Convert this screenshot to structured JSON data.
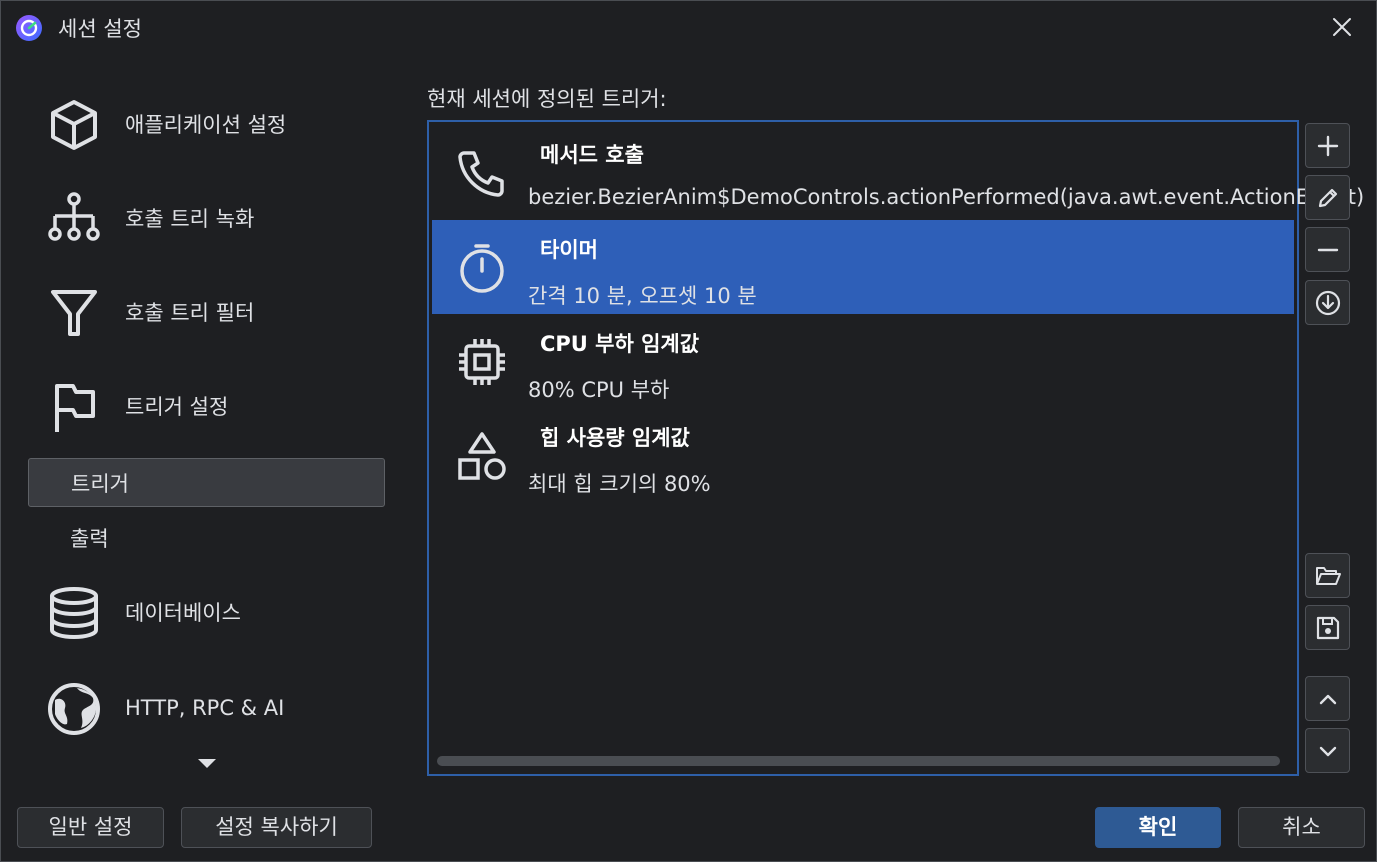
{
  "window": {
    "title": "세션 설정",
    "app_icon": "app-logo-icon",
    "close_icon": "close-icon"
  },
  "sidebar": {
    "items": [
      {
        "label": "애플리케이션 설정",
        "icon": "cube-icon"
      },
      {
        "label": "호출 트리 녹화",
        "icon": "tree-icon"
      },
      {
        "label": "호출 트리 필터",
        "icon": "filter-icon"
      },
      {
        "label": "트리거 설정",
        "icon": "flag-icon"
      },
      {
        "label": "데이터베이스",
        "icon": "database-icon"
      },
      {
        "label": "HTTP, RPC & AI",
        "icon": "globe-icon"
      }
    ],
    "subitems": [
      {
        "label": "트리거",
        "selected": true
      },
      {
        "label": "출력",
        "selected": false
      }
    ],
    "more_icon": "chevron-down-icon"
  },
  "main": {
    "label": "현재 세션에 정의된 트리거:",
    "triggers": [
      {
        "title": "메서드 호출",
        "desc": "bezier.BezierAnim$DemoControls.actionPerformed(java.awt.event.ActionEvent)",
        "icon": "phone-icon",
        "selected": false
      },
      {
        "title": "타이머",
        "desc": "간격 10 분, 오프셋 10 분",
        "icon": "stopwatch-icon",
        "selected": true
      },
      {
        "title": "CPU 부하 임계값",
        "desc": "80% CPU 부하",
        "icon": "cpu-icon",
        "selected": false
      },
      {
        "title": "힙 사용량 임계값",
        "desc": "최대 힙 크기의 80%",
        "icon": "shapes-icon",
        "selected": false
      }
    ]
  },
  "side_buttons": [
    "plus-icon",
    "edit-icon",
    "minus-icon",
    "import-icon",
    "folder-open-icon",
    "save-icon",
    "chevron-up-icon",
    "chevron-down-icon"
  ],
  "buttons": {
    "general": "일반 설정",
    "copy": "설정 복사하기",
    "ok": "확인",
    "cancel": "취소"
  },
  "colors": {
    "accent": "#2e5fb8",
    "primary_button": "#2e5a94",
    "background": "#1e1f22"
  }
}
